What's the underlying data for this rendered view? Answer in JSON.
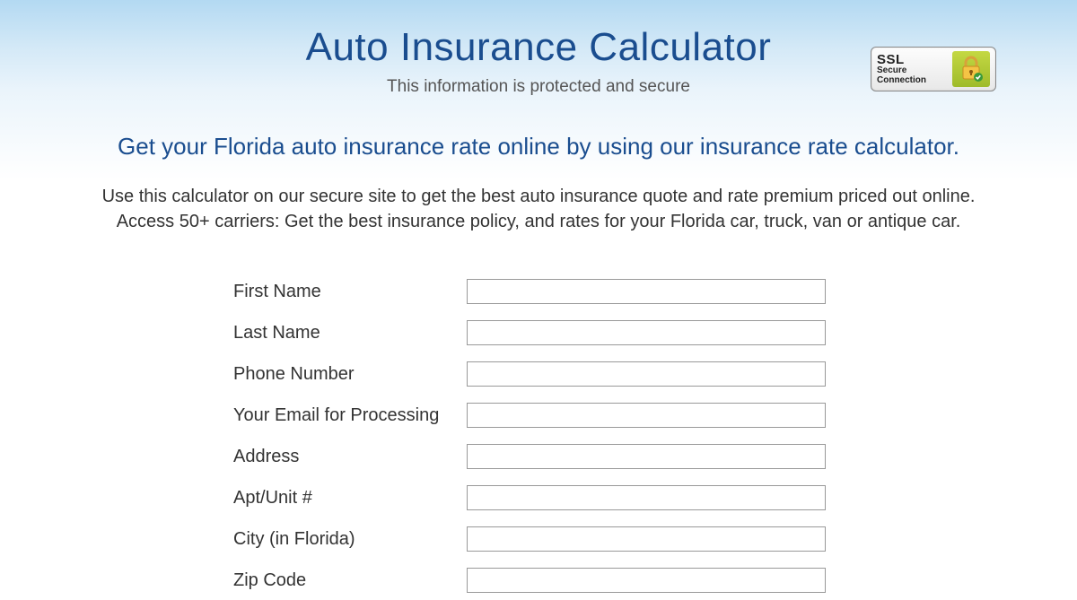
{
  "header": {
    "title": "Auto Insurance Calculator",
    "subtitle": "This information is protected and secure"
  },
  "ssl_badge": {
    "line1": "SSL",
    "line2": "Secure",
    "line3": "Connection"
  },
  "intro": {
    "heading": "Get your Florida auto insurance rate online by using our insurance rate calculator.",
    "body_line1": "Use this calculator on our secure site to get the best auto insurance quote and rate premium priced out online.",
    "body_line2": "Access 50+ carriers: Get the best insurance policy, and rates for your Florida car, truck, van or antique car."
  },
  "form": {
    "fields": [
      {
        "label": "First Name",
        "value": ""
      },
      {
        "label": "Last Name",
        "value": ""
      },
      {
        "label": "Phone Number",
        "value": ""
      },
      {
        "label": "Your Email for Processing",
        "value": ""
      },
      {
        "label": "Address",
        "value": ""
      },
      {
        "label": "Apt/Unit #",
        "value": ""
      },
      {
        "label": "City (in Florida)",
        "value": ""
      },
      {
        "label": "Zip Code",
        "value": ""
      }
    ]
  }
}
